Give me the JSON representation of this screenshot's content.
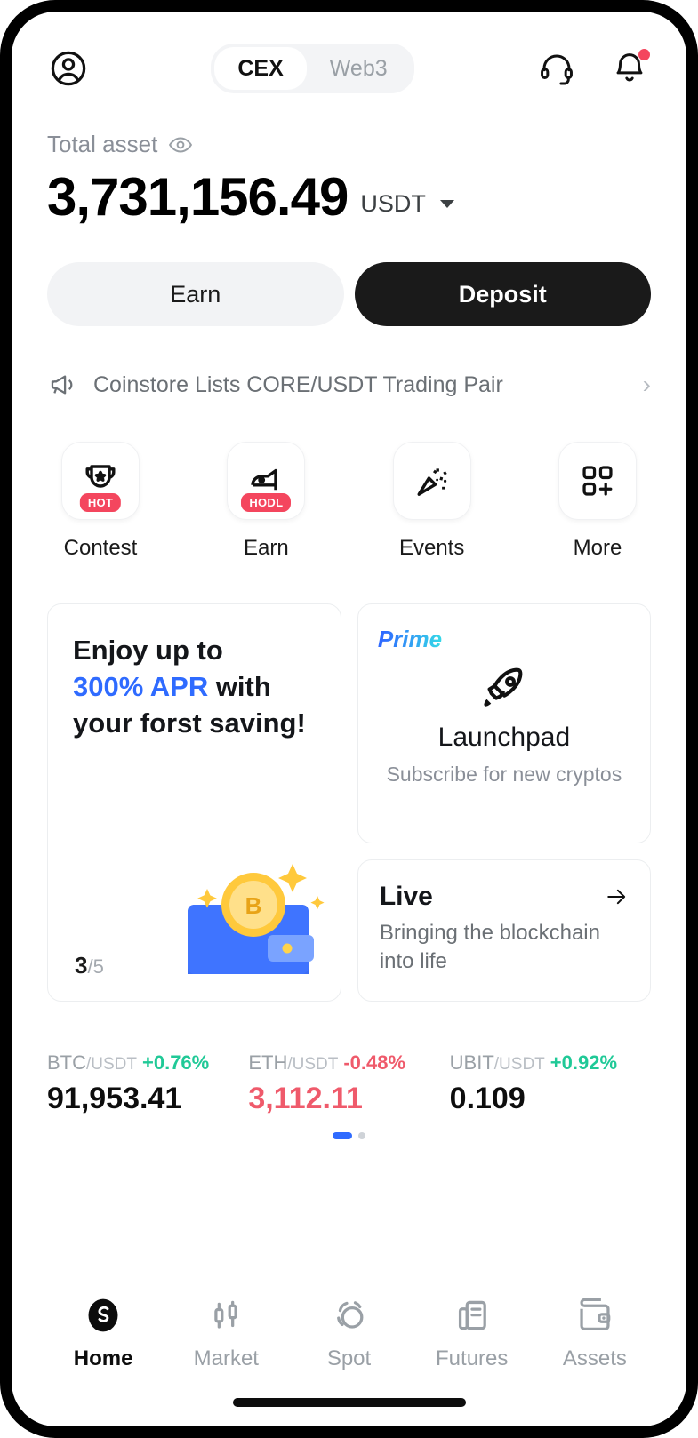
{
  "header": {
    "profile_icon": "user-circle-icon",
    "tabs": [
      {
        "label": "CEX",
        "active": true
      },
      {
        "label": "Web3",
        "active": false
      }
    ],
    "support_icon": "headset-icon",
    "notification_icon": "bell-icon",
    "has_notification_dot": true
  },
  "balance": {
    "label": "Total asset",
    "eye_icon": "eye-icon",
    "amount": "3,731,156.49",
    "currency": "USDT"
  },
  "actions": {
    "earn_label": "Earn",
    "deposit_label": "Deposit"
  },
  "announcement": {
    "icon": "megaphone-icon",
    "text": "Coinstore Lists CORE/USDT Trading Pair",
    "chevron": "chevron-right-icon"
  },
  "quick_actions": [
    {
      "label": "Contest",
      "icon": "trophy-icon",
      "badge": "HOT"
    },
    {
      "label": "Earn",
      "icon": "piggy-savings-icon",
      "badge": "HODL"
    },
    {
      "label": "Events",
      "icon": "party-popper-icon",
      "badge": ""
    },
    {
      "label": "More",
      "icon": "grid-plus-icon",
      "badge": ""
    }
  ],
  "promo": {
    "savings_card": {
      "line1": "Enjoy up to",
      "highlight": "300% APR",
      "line2_rest": " with",
      "line3": "your forst saving!",
      "counter_current": "3",
      "counter_total": "/5",
      "art": "bitcoin-wallet-illustration"
    },
    "launchpad_card": {
      "tag": "Prime",
      "icon": "rocket-icon",
      "title": "Launchpad",
      "subtitle": "Subscribe for new cryptos"
    },
    "live_card": {
      "title": "Live",
      "arrow_icon": "arrow-right-icon",
      "subtitle": "Bringing the blockchain into life"
    }
  },
  "tickers": [
    {
      "base": "BTC",
      "quote": "/USDT",
      "change": "+0.76%",
      "direction": "up",
      "price": "91,953.41",
      "price_color": "neutral"
    },
    {
      "base": "ETH",
      "quote": "/USDT",
      "change": "-0.48%",
      "direction": "down",
      "price": "3,112.11",
      "price_color": "down"
    },
    {
      "base": "UBIT",
      "quote": "/USDT",
      "change": "+0.92%",
      "direction": "up",
      "price": "0.109",
      "price_color": "neutral"
    }
  ],
  "pagination": {
    "total": 2,
    "active_index": 0
  },
  "bottom_nav": [
    {
      "label": "Home",
      "icon": "home-logo-icon",
      "active": true
    },
    {
      "label": "Market",
      "icon": "candlestick-icon",
      "active": false
    },
    {
      "label": "Spot",
      "icon": "swap-circles-icon",
      "active": false
    },
    {
      "label": "Futures",
      "icon": "futures-document-icon",
      "active": false
    },
    {
      "label": "Assets",
      "icon": "wallet-icon",
      "active": false
    }
  ],
  "colors": {
    "accent_blue": "#2f6bff",
    "up_green": "#20c997",
    "down_red": "#ef5a6b",
    "badge_red": "#f4465e",
    "dark": "#1a1a1a"
  }
}
